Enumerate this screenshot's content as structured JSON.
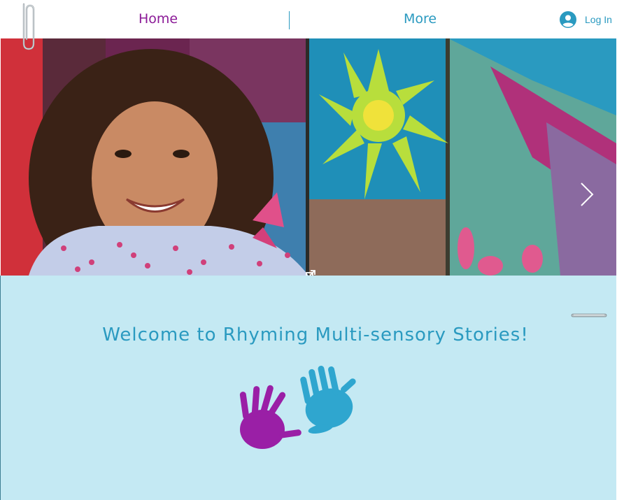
{
  "header": {
    "nav": {
      "home_label": "Home",
      "more_label": "More"
    },
    "login_label": "Log In"
  },
  "hero": {
    "next_icon": "chevron-right-icon",
    "expand_icon": "expand-icon"
  },
  "welcome": {
    "title": "Welcome to Rhyming Multi-sensory Stories!"
  },
  "colors": {
    "home": "#8b1a97",
    "accent": "#2a9ac0",
    "section_bg": "#c4e9f3",
    "purple_hand": "#9a1fa6",
    "blue_hand": "#2fa6cf"
  }
}
